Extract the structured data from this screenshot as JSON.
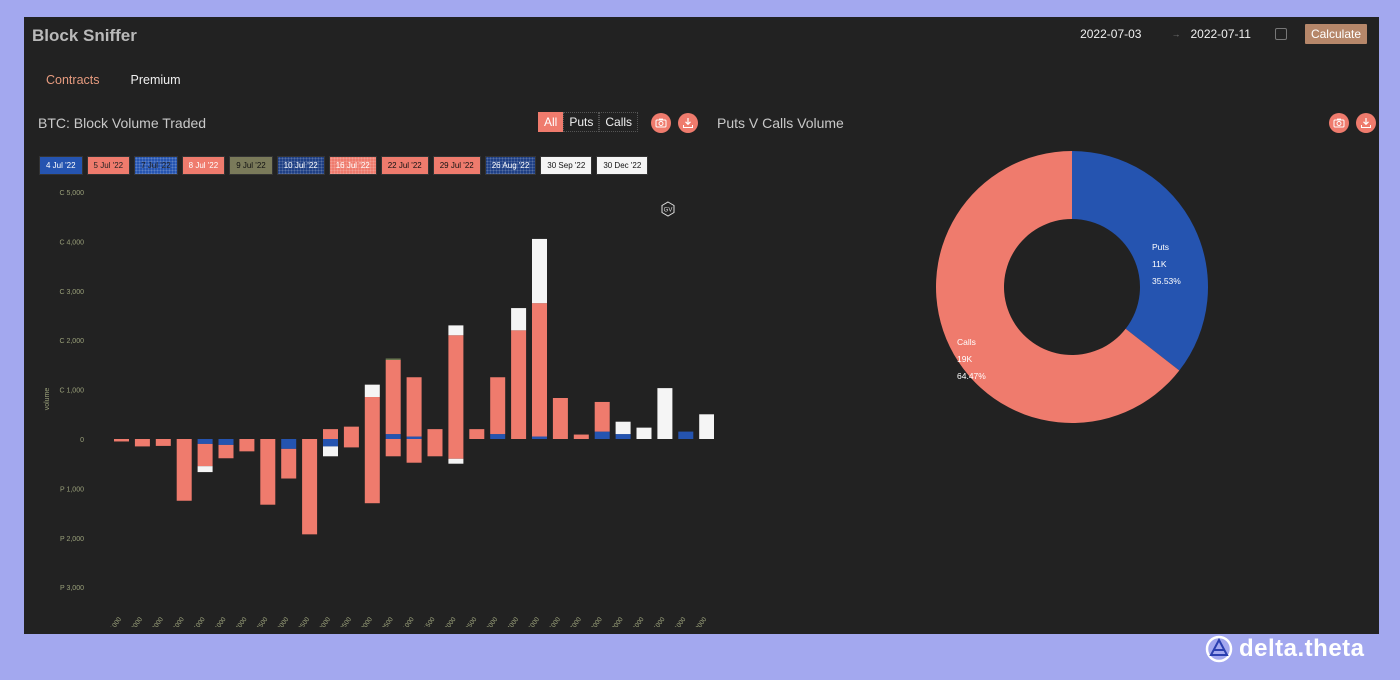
{
  "app": {
    "title": "Block Sniffer"
  },
  "date_range": {
    "start": "2022-07-03",
    "arrow": "→",
    "end": "2022-07-11",
    "calculate_label": "Calculate"
  },
  "tabs": [
    {
      "label": "Contracts",
      "active": true
    },
    {
      "label": "Premium",
      "active": false
    }
  ],
  "left_panel": {
    "title": "BTC: Block Volume Traded",
    "filters": [
      {
        "label": "All",
        "active": true
      },
      {
        "label": "Puts",
        "active": false
      },
      {
        "label": "Calls",
        "active": false
      }
    ],
    "icons": [
      "camera-icon",
      "download-icon"
    ],
    "expiries": [
      {
        "label": "4 Jul '22",
        "color": "#2554b0",
        "text": "#ffffff"
      },
      {
        "label": "5 Jul '22",
        "color": "#ef7b6d",
        "text": "#222222"
      },
      {
        "label": "7 Jul '22",
        "color": "#2554b0",
        "text": "#222222",
        "dotted": true
      },
      {
        "label": "8 Jul '22",
        "color": "#ef7b6d",
        "text": "#ffffff"
      },
      {
        "label": "9 Jul '22",
        "color": "#7a7a5a",
        "text": "#111111"
      },
      {
        "label": "10 Jul '22",
        "color": "#1e3f85",
        "text": "#ffffff",
        "dotted": true
      },
      {
        "label": "16 Jul '22",
        "color": "#ef7b6d",
        "text": "#ffffff",
        "dotted": true
      },
      {
        "label": "22 Jul '22",
        "color": "#ef7b6d",
        "text": "#111111"
      },
      {
        "label": "29 Jul '22",
        "color": "#ef7b6d",
        "text": "#111111"
      },
      {
        "label": "26 Aug '22",
        "color": "#1e3f85",
        "text": "#ffffff",
        "dotted": true
      },
      {
        "label": "30 Sep '22",
        "color": "#f5f5f5",
        "text": "#111111"
      },
      {
        "label": "30 Dec '22",
        "color": "#f5f5f5",
        "text": "#111111"
      }
    ]
  },
  "right_panel": {
    "title": "Puts V Calls Volume",
    "icons": [
      "camera-icon",
      "download-icon"
    ]
  },
  "chart_data": [
    {
      "type": "bar",
      "title": "BTC: Block Volume Traded",
      "ylabel": "volume",
      "ytick_labels": [
        "C 5,000",
        "C 4,000",
        "C 3,000",
        "C 2,000",
        "C 1,000",
        "0",
        "P 1,000",
        "P 2,000",
        "P 3,000"
      ],
      "ylim": [
        -3000,
        5000
      ],
      "categories": [
        "11000",
        "12000",
        "13000",
        "14000",
        "15000",
        "16000",
        "17000",
        "17500",
        "18000",
        "18500",
        "19000",
        "19500",
        "20000",
        "20500",
        "21000",
        "21500",
        "22000",
        "22500",
        "23000",
        "24000",
        "25000",
        "26000",
        "27000",
        "28000",
        "30000",
        "34000",
        "35000",
        "36000",
        "40000"
      ],
      "series": [
        {
          "name": "4 Jul '22",
          "color": "#2554b0",
          "call": [
            0,
            0,
            0,
            0,
            0,
            0,
            0,
            0,
            0,
            0,
            0,
            0,
            0,
            100,
            50,
            0,
            0,
            0,
            100,
            0,
            50,
            0,
            0,
            150,
            100,
            0,
            0,
            150,
            0
          ],
          "put": [
            0,
            0,
            0,
            0,
            100,
            120,
            0,
            0,
            200,
            0,
            150,
            0,
            0,
            0,
            0,
            0,
            0,
            0,
            0,
            0,
            0,
            0,
            0,
            0,
            0,
            0,
            0,
            0,
            0
          ]
        },
        {
          "name": "5 Jul '22",
          "color": "#ef7b6d",
          "call": [
            0,
            0,
            0,
            0,
            0,
            0,
            0,
            0,
            0,
            0,
            200,
            250,
            850,
            1500,
            1200,
            200,
            2100,
            200,
            1150,
            2200,
            2700,
            830,
            90,
            600,
            0,
            0,
            0,
            0,
            0
          ],
          "put": [
            50,
            150,
            140,
            1250,
            450,
            270,
            250,
            1330,
            600,
            1930,
            0,
            170,
            1300,
            350,
            480,
            350,
            400,
            0,
            0,
            0,
            0,
            0,
            0,
            0,
            0,
            0,
            0,
            0,
            0
          ]
        },
        {
          "name": "30 Sep '22",
          "color": "#f5f5f5",
          "call": [
            0,
            0,
            0,
            0,
            0,
            0,
            0,
            0,
            0,
            0,
            0,
            0,
            250,
            0,
            0,
            0,
            200,
            0,
            0,
            450,
            1300,
            0,
            0,
            0,
            250,
            230,
            1030,
            0,
            500
          ],
          "put": [
            0,
            0,
            0,
            0,
            120,
            0,
            0,
            0,
            0,
            0,
            200,
            0,
            0,
            0,
            0,
            0,
            100,
            0,
            0,
            0,
            0,
            0,
            0,
            0,
            0,
            0,
            0,
            0,
            0
          ]
        },
        {
          "name": "9 Jul '22",
          "color": "#6d7a52",
          "call": [
            0,
            0,
            0,
            0,
            0,
            0,
            0,
            0,
            0,
            0,
            0,
            0,
            0,
            30,
            0,
            0,
            0,
            0,
            0,
            0,
            0,
            0,
            0,
            0,
            0,
            0,
            0,
            0,
            0
          ],
          "put": [
            0,
            0,
            0,
            0,
            0,
            0,
            0,
            0,
            0,
            0,
            0,
            0,
            0,
            0,
            0,
            0,
            0,
            0,
            0,
            0,
            0,
            0,
            0,
            0,
            0,
            0,
            0,
            0,
            0
          ]
        }
      ]
    },
    {
      "type": "pie",
      "title": "Puts V Calls Volume",
      "slices": [
        {
          "label": "Puts",
          "value_label": "11K",
          "percent_label": "35.53%",
          "value": 35.53,
          "color": "#2554b0"
        },
        {
          "label": "Calls",
          "value_label": "19K",
          "percent_label": "64.47%",
          "value": 64.47,
          "color": "#ef7b6d"
        }
      ]
    }
  ],
  "brand": {
    "name": "delta.theta"
  }
}
